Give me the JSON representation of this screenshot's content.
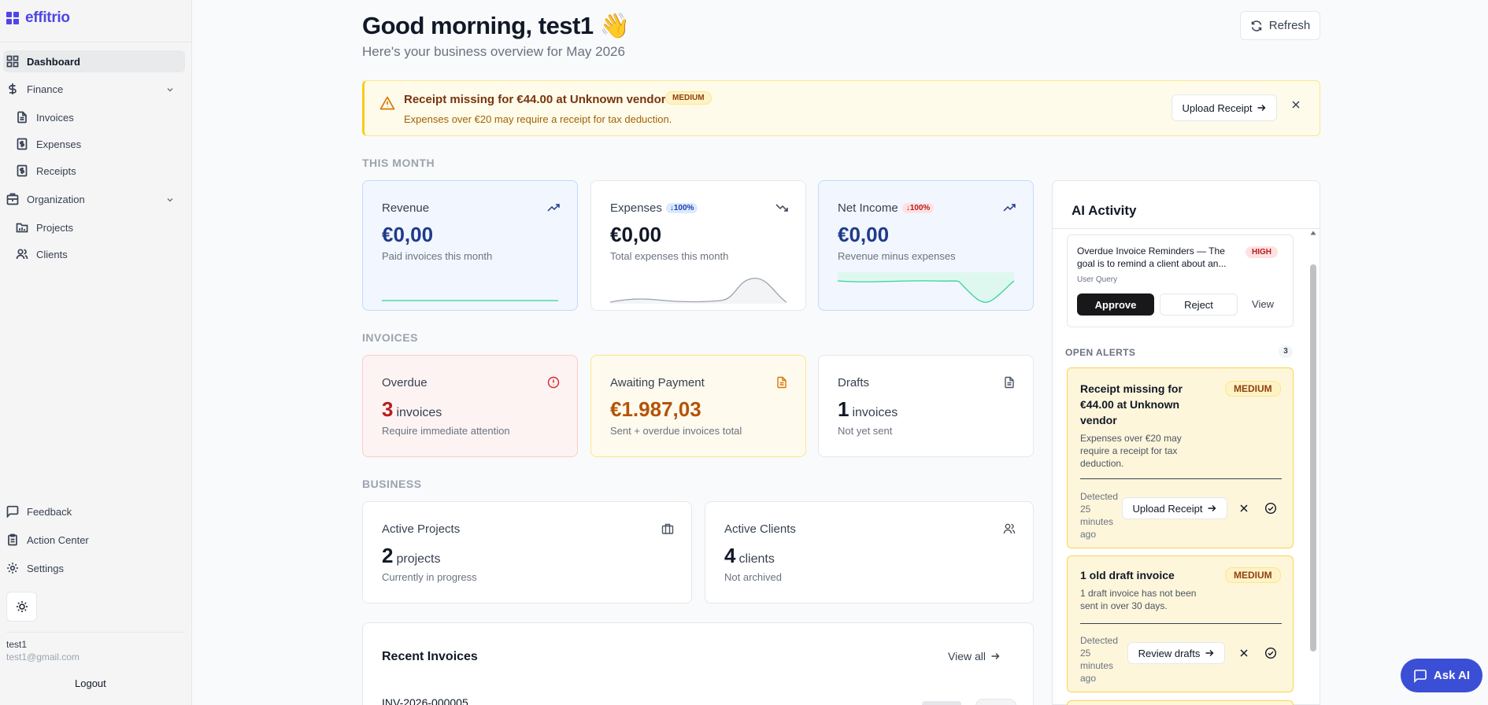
{
  "app": {
    "name": "effitrio",
    "brand_color": "#4f46e5"
  },
  "sidebar": {
    "dashboard": "Dashboard",
    "finance": "Finance",
    "invoices": "Invoices",
    "expenses": "Expenses",
    "receipts": "Receipts",
    "organization": "Organization",
    "projects": "Projects",
    "clients": "Clients",
    "feedback": "Feedback",
    "action_center": "Action Center",
    "settings": "Settings",
    "user_name": "test1",
    "user_email": "test1@gmail.com",
    "logout": "Logout"
  },
  "header": {
    "greeting": "Good morning, test1",
    "emoji": "👋",
    "subtitle": "Here's your business overview for May 2026",
    "refresh": "Refresh"
  },
  "banner": {
    "title": "Receipt missing for €44.00 at Unknown vendor",
    "badge": "MEDIUM",
    "description": "Expenses over €20 may require a receipt for tax deduction.",
    "action": "Upload Receipt"
  },
  "this_month": {
    "label": "THIS MONTH",
    "revenue": {
      "title": "Revenue",
      "value": "€0,00",
      "sub": "Paid invoices this month"
    },
    "expenses": {
      "title": "Expenses",
      "badge": "↓100%",
      "value": "€0,00",
      "sub": "Total expenses this month"
    },
    "net": {
      "title": "Net Income",
      "badge": "↓100%",
      "value": "€0,00",
      "sub": "Revenue minus expenses"
    }
  },
  "invoices": {
    "label": "INVOICES",
    "overdue": {
      "title": "Overdue",
      "value": "3",
      "unit": "invoices",
      "sub": "Require immediate attention"
    },
    "awaiting": {
      "title": "Awaiting Payment",
      "value": "€1.987,03",
      "sub": "Sent + overdue invoices total"
    },
    "drafts": {
      "title": "Drafts",
      "value": "1",
      "unit": "invoices",
      "sub": "Not yet sent"
    }
  },
  "business": {
    "label": "BUSINESS",
    "projects": {
      "title": "Active Projects",
      "value": "2",
      "unit": "projects",
      "sub": "Currently in progress"
    },
    "clients": {
      "title": "Active Clients",
      "value": "4",
      "unit": "clients",
      "sub": "Not archived"
    }
  },
  "recent": {
    "title": "Recent Invoices",
    "view_all": "View all",
    "first_row": "INV-2026-000005"
  },
  "ai": {
    "title": "AI Activity",
    "query": {
      "text": "Overdue Invoice Reminders — The goal is to remind a client about an...",
      "badge": "HIGH",
      "type": "User Query",
      "approve": "Approve",
      "reject": "Reject",
      "view": "View"
    },
    "open_alerts_label": "OPEN ALERTS",
    "open_alerts_count": "3",
    "alerts": [
      {
        "title": "Receipt missing for €44.00 at Unknown vendor",
        "badge": "MEDIUM",
        "description": "Expenses over €20 may require a receipt for tax deduction.",
        "detected": "Detected 25 minutes ago",
        "action": "Upload Receipt"
      },
      {
        "title": "1 old draft invoice",
        "badge": "MEDIUM",
        "description": "1 draft invoice has not been sent in over 30 days.",
        "detected": "Detected 25 minutes ago",
        "action": "Review drafts"
      }
    ]
  },
  "ask_ai": "Ask AI"
}
